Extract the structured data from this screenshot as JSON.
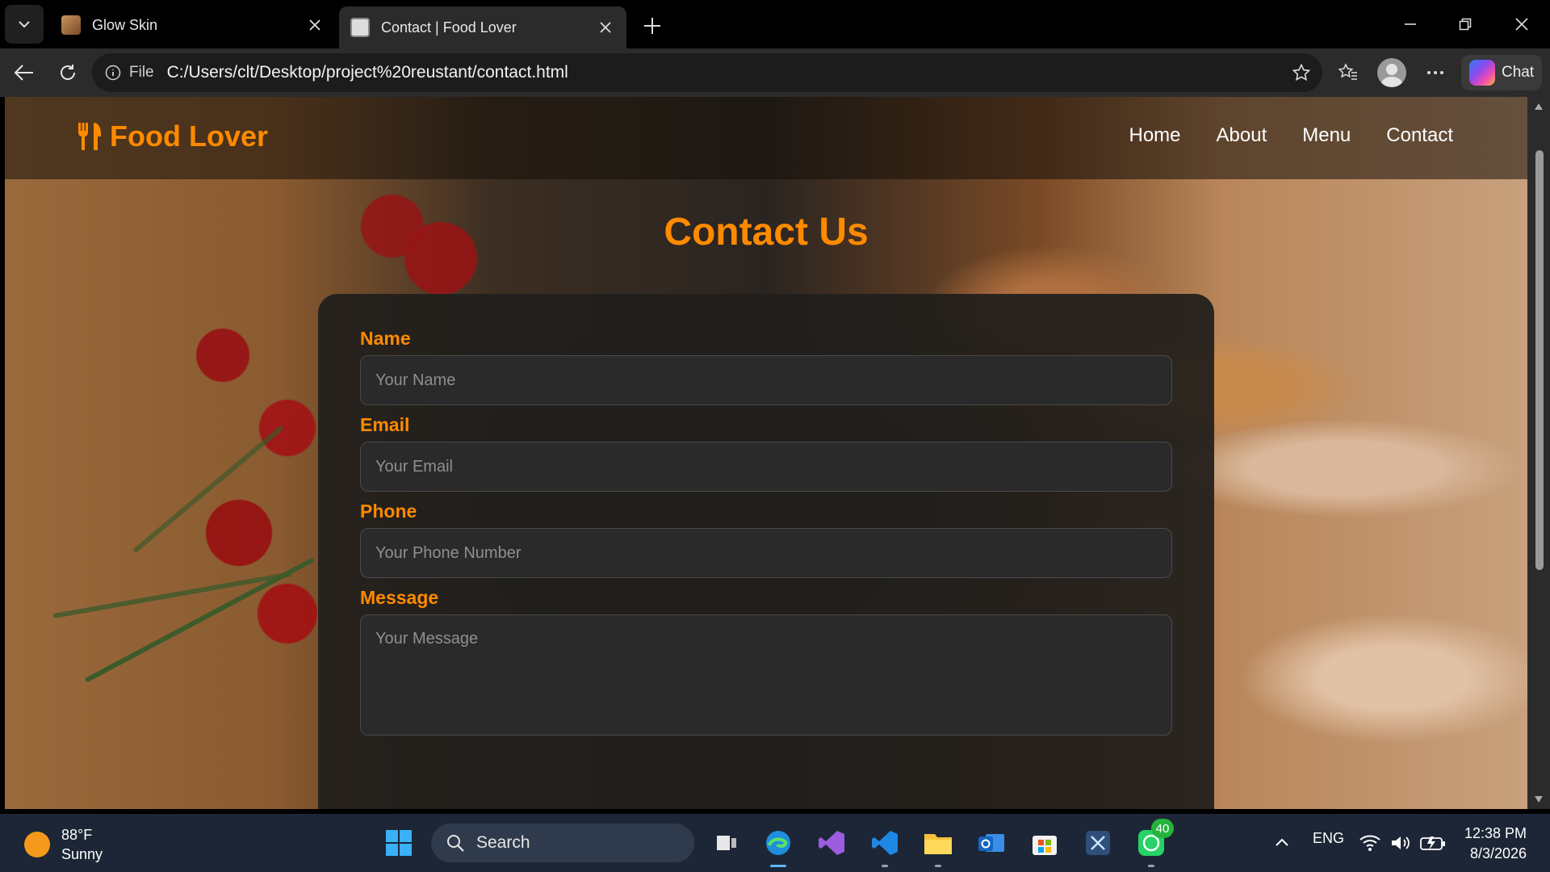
{
  "browser": {
    "tabs": [
      {
        "title": "Glow Skin",
        "active": false
      },
      {
        "title": "Contact | Food Lover",
        "active": true
      }
    ],
    "address": {
      "scheme_label": "File",
      "url": "C:/Users/clt/Desktop/project%20reustant/contact.html"
    },
    "chat_label": "Chat"
  },
  "site": {
    "brand": "Food Lover",
    "nav": [
      "Home",
      "About",
      "Menu",
      "Contact"
    ],
    "page_title": "Contact Us",
    "form": {
      "name": {
        "label": "Name",
        "placeholder": "Your Name"
      },
      "email": {
        "label": "Email",
        "placeholder": "Your Email"
      },
      "phone": {
        "label": "Phone",
        "placeholder": "Your Phone Number"
      },
      "message": {
        "label": "Message",
        "placeholder": "Your Message"
      }
    },
    "colors": {
      "accent": "#ff8a00"
    }
  },
  "taskbar": {
    "weather": {
      "temp": "88°F",
      "condition": "Sunny"
    },
    "search_label": "Search",
    "whatsapp_badge": "40",
    "language": "ENG",
    "time": "12:38 PM",
    "date": "8/3/2026"
  }
}
